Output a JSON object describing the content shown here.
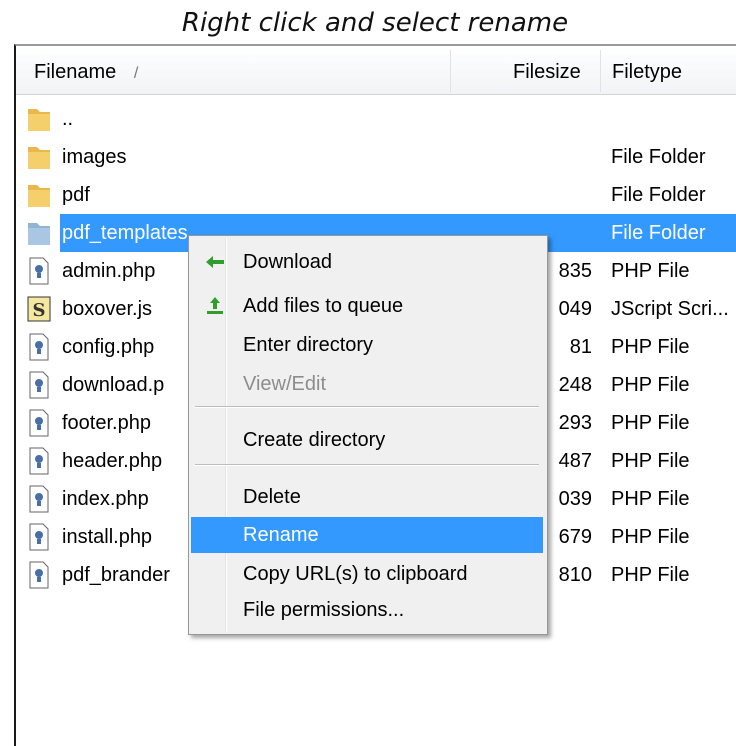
{
  "caption": "Right click and select rename",
  "header": {
    "filename": "Filename",
    "sort_glyph": "/",
    "filesize": "Filesize",
    "filetype": "Filetype"
  },
  "files": [
    {
      "name": "..",
      "size": "",
      "type": "",
      "icon": "folder-icon"
    },
    {
      "name": "images",
      "size": "",
      "type": "File Folder",
      "icon": "folder-icon"
    },
    {
      "name": "pdf",
      "size": "",
      "type": "File Folder",
      "icon": "folder-icon"
    },
    {
      "name": "pdf_templates",
      "size": "",
      "type": "File Folder",
      "icon": "folder-icon",
      "selected": true
    },
    {
      "name": "admin.php",
      "size": "835",
      "type": "PHP File",
      "icon": "php-file-icon"
    },
    {
      "name": "boxover.js",
      "size": "049",
      "type": "JScript Scri...",
      "icon": "jscript-file-icon"
    },
    {
      "name": "config.php",
      "size": "81",
      "type": "PHP File",
      "icon": "php-file-icon"
    },
    {
      "name": "download.p",
      "size": "248",
      "type": "PHP File",
      "icon": "php-file-icon"
    },
    {
      "name": "footer.php",
      "size": "293",
      "type": "PHP File",
      "icon": "php-file-icon"
    },
    {
      "name": "header.php",
      "size": "487",
      "type": "PHP File",
      "icon": "php-file-icon"
    },
    {
      "name": "index.php",
      "size": "039",
      "type": "PHP File",
      "icon": "php-file-icon"
    },
    {
      "name": "install.php",
      "size": "679",
      "type": "PHP File",
      "icon": "php-file-icon"
    },
    {
      "name": "pdf_brander",
      "size": "810",
      "type": "PHP File",
      "icon": "php-file-icon"
    }
  ],
  "context_menu": {
    "items": [
      {
        "label": "Download",
        "icon": "download-arrow-icon"
      },
      {
        "label": "Add files to queue",
        "icon": "add-to-queue-icon"
      },
      {
        "label": "Enter directory"
      },
      {
        "label": "View/Edit",
        "disabled": true
      },
      {
        "label": "Create directory"
      },
      {
        "label": "Delete"
      },
      {
        "label": "Rename",
        "highlighted": true
      },
      {
        "label": "Copy URL(s) to clipboard"
      },
      {
        "label": "File permissions..."
      }
    ]
  },
  "colors": {
    "selection": "#3399ff",
    "folder": "#e8b84a",
    "menu_bg": "#f0f0f0",
    "download_arrow": "#2f9e2f"
  }
}
